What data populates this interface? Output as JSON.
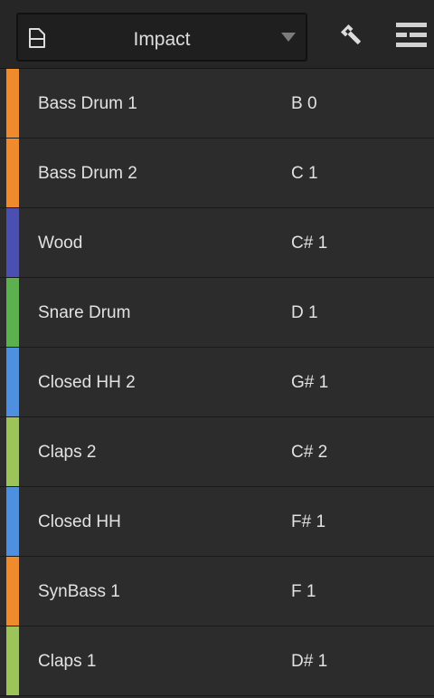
{
  "header": {
    "preset_name": "Impact",
    "icons": {
      "preset": "document-icon",
      "dropdown": "chevron-down-icon",
      "settings": "wrench-icon",
      "view": "list-view-icon"
    }
  },
  "rows": [
    {
      "name": "Bass Drum 1",
      "note": "B 0",
      "color": "#ef8b2c"
    },
    {
      "name": "Bass Drum 2",
      "note": "C 1",
      "color": "#ef8b2c"
    },
    {
      "name": "Wood",
      "note": "C# 1",
      "color": "#4a4fb0"
    },
    {
      "name": "Snare Drum",
      "note": "D 1",
      "color": "#5cb04e"
    },
    {
      "name": "Closed HH 2",
      "note": "G# 1",
      "color": "#4f8fe0"
    },
    {
      "name": "Claps 2",
      "note": "C# 2",
      "color": "#9cc45a"
    },
    {
      "name": "Closed HH",
      "note": "F# 1",
      "color": "#4f8fe0"
    },
    {
      "name": "SynBass 1",
      "note": "F 1",
      "color": "#ef8b2c"
    },
    {
      "name": "Claps 1",
      "note": "D# 1",
      "color": "#9cc45a"
    }
  ]
}
